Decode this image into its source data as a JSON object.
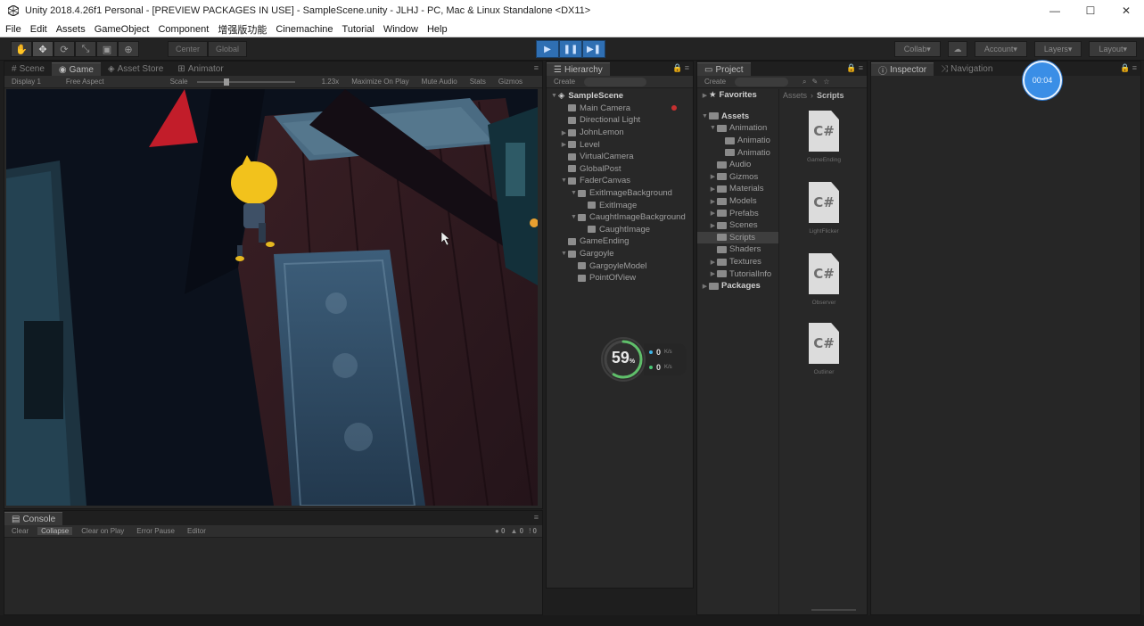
{
  "window": {
    "title": "Unity 2018.4.26f1 Personal - [PREVIEW PACKAGES IN USE] - SampleScene.unity - JLHJ - PC, Mac & Linux Standalone <DX11>",
    "minimize": "—",
    "maximize": "☐",
    "close": "✕"
  },
  "menu": [
    "File",
    "Edit",
    "Assets",
    "GameObject",
    "Component",
    "增强版功能",
    "Cinemachine",
    "Tutorial",
    "Window",
    "Help"
  ],
  "toolbar": {
    "tools": [
      "✋",
      "✥",
      "⟳",
      "⤡",
      "▣",
      "⊕"
    ],
    "pivot": "Center",
    "global": "Global",
    "play": [
      "▶",
      "❚❚",
      "▶❚"
    ],
    "collab": "Collab",
    "account": "Account",
    "layers": "Layers",
    "layout": "Layout"
  },
  "scene_panel": {
    "tabs": [
      "Scene",
      "Game",
      "Asset Store",
      "Animator"
    ],
    "controls": [
      "Display 1",
      "Free Aspect",
      "Scale",
      "1.23x",
      "Maximize On Play",
      "Mute Audio",
      "Stats",
      "Gizmos"
    ]
  },
  "hierarchy": {
    "tab": "Hierarchy",
    "create": "Create",
    "scene": "SampleScene",
    "items": [
      {
        "label": "Main Camera",
        "depth": 1,
        "arrow": ""
      },
      {
        "label": "Directional Light",
        "depth": 1,
        "arrow": ""
      },
      {
        "label": "JohnLemon",
        "depth": 1,
        "arrow": "▶"
      },
      {
        "label": "Level",
        "depth": 1,
        "arrow": "▶"
      },
      {
        "label": "VirtualCamera",
        "depth": 1,
        "arrow": ""
      },
      {
        "label": "GlobalPost",
        "depth": 1,
        "arrow": ""
      },
      {
        "label": "FaderCanvas",
        "depth": 1,
        "arrow": "▼"
      },
      {
        "label": "ExitImageBackground",
        "depth": 2,
        "arrow": "▼"
      },
      {
        "label": "ExitImage",
        "depth": 3,
        "arrow": ""
      },
      {
        "label": "CaughtImageBackground",
        "depth": 2,
        "arrow": "▼"
      },
      {
        "label": "CaughtImage",
        "depth": 3,
        "arrow": ""
      },
      {
        "label": "GameEnding",
        "depth": 1,
        "arrow": ""
      },
      {
        "label": "Gargoyle",
        "depth": 1,
        "arrow": "▼"
      },
      {
        "label": "GargoyleModel",
        "depth": 2,
        "arrow": ""
      },
      {
        "label": "PointOfView",
        "depth": 2,
        "arrow": ""
      }
    ]
  },
  "project": {
    "tab": "Project",
    "create": "Create",
    "favorites": "Favorites",
    "crumb": [
      "Assets",
      "Scripts"
    ],
    "tree": [
      {
        "label": "Assets",
        "depth": 0,
        "arrow": "▼",
        "bold": true
      },
      {
        "label": "Animation",
        "depth": 1,
        "arrow": "▼"
      },
      {
        "label": "Animatio",
        "depth": 2,
        "arrow": ""
      },
      {
        "label": "Animatio",
        "depth": 2,
        "arrow": ""
      },
      {
        "label": "Audio",
        "depth": 1,
        "arrow": ""
      },
      {
        "label": "Gizmos",
        "depth": 1,
        "arrow": "▶"
      },
      {
        "label": "Materials",
        "depth": 1,
        "arrow": "▶"
      },
      {
        "label": "Models",
        "depth": 1,
        "arrow": "▶"
      },
      {
        "label": "Prefabs",
        "depth": 1,
        "arrow": "▶"
      },
      {
        "label": "Scenes",
        "depth": 1,
        "arrow": "▶"
      },
      {
        "label": "Scripts",
        "depth": 1,
        "arrow": "",
        "selected": true
      },
      {
        "label": "Shaders",
        "depth": 1,
        "arrow": ""
      },
      {
        "label": "Textures",
        "depth": 1,
        "arrow": "▶"
      },
      {
        "label": "TutorialInfo",
        "depth": 1,
        "arrow": "▶"
      },
      {
        "label": "Packages",
        "depth": 0,
        "arrow": "▶",
        "bold": true
      }
    ],
    "scripts": [
      {
        "label": "GameEnding",
        "glyph": "C#"
      },
      {
        "label": "LightFlicker",
        "glyph": "C#"
      },
      {
        "label": "Observer",
        "glyph": "C#"
      },
      {
        "label": "Outliner",
        "glyph": "C#"
      }
    ]
  },
  "inspector": {
    "tabs": [
      "Inspector",
      "Navigation"
    ]
  },
  "console": {
    "tab": "Console",
    "buttons": [
      "Clear",
      "Collapse",
      "Clear on Play",
      "Error Pause",
      "Editor"
    ],
    "counts": [
      "0",
      "0",
      "0"
    ]
  },
  "perf": {
    "cpu": "59",
    "unit": "%",
    "up": "0",
    "down": "0",
    "up_unit": "K/s",
    "down_unit": "K/s"
  },
  "timer": "00:04",
  "colors": {
    "accent": "#3a8ee6",
    "play_blue": "#2f6fb3",
    "panel": "#282828",
    "dark": "#1e1e1e"
  }
}
